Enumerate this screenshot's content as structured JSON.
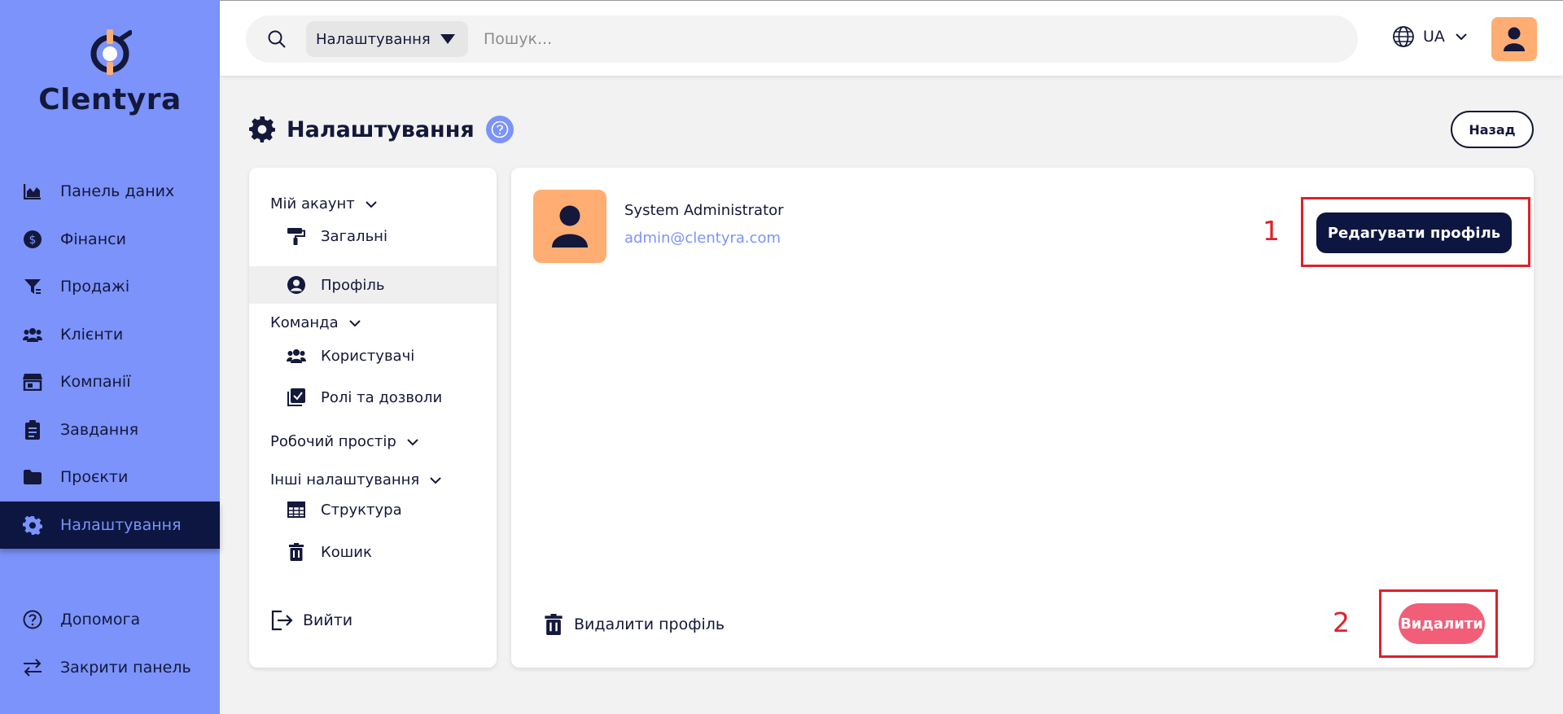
{
  "app": {
    "name": "Clentyra"
  },
  "sidebar": {
    "items": [
      {
        "label": "Панель даних",
        "icon": "chart-area-icon"
      },
      {
        "label": "Фінанси",
        "icon": "dollar-circle-icon"
      },
      {
        "label": "Продажі",
        "icon": "funnel-icon"
      },
      {
        "label": "Клієнти",
        "icon": "users-icon"
      },
      {
        "label": "Компанії",
        "icon": "store-icon"
      },
      {
        "label": "Завдання",
        "icon": "clipboard-icon"
      },
      {
        "label": "Проєкти",
        "icon": "folder-icon"
      },
      {
        "label": "Налаштування",
        "icon": "gear-icon",
        "active": true
      }
    ],
    "bottom": [
      {
        "label": "Допомога",
        "icon": "question-circle-icon"
      },
      {
        "label": "Закрити панель",
        "icon": "arrows-swap-icon"
      }
    ]
  },
  "topbar": {
    "scope": "Налаштування",
    "search_placeholder": "Пошук...",
    "language": "UA"
  },
  "page": {
    "title": "Налаштування",
    "back_label": "Назад"
  },
  "settings_menu": {
    "my_account": "Мій акаунт",
    "general": "Загальні",
    "profile": "Профіль",
    "team": "Команда",
    "users": "Користувачі",
    "roles": "Ролі та дозволи",
    "workspace": "Робочий простір",
    "other": "Інші налаштування",
    "structure": "Структура",
    "trash": "Кошик",
    "logout": "Вийти"
  },
  "profile": {
    "name": "System Administrator",
    "email": "admin@clentyra.com",
    "edit_label": "Редагувати профіль",
    "delete_profile_label": "Видалити профіль",
    "delete_button": "Видалити"
  },
  "annotations": {
    "marker1": "1",
    "marker2": "2",
    "color": "#e0202a"
  },
  "colors": {
    "sidebar": "#7b93fb",
    "navy": "#0d1640",
    "accent_orange": "#ffad72",
    "danger": "#f25e78"
  }
}
